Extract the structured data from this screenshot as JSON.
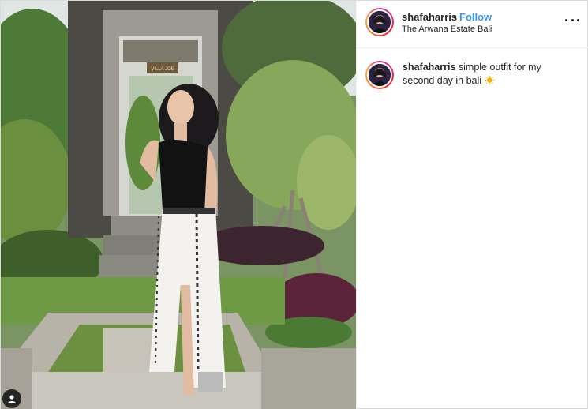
{
  "post": {
    "username": "shafaharris",
    "separator": "•",
    "follow_label": "Follow",
    "location": "The Arwana Estate Bali",
    "more_icon": "more-options-icon",
    "photo_sign_text": "VILLA JOE"
  },
  "caption": {
    "username": "shafaharris",
    "text": "simple outfit for my second day in bali",
    "emoji": "sun-emoji"
  },
  "colors": {
    "follow_blue": "#3897f0",
    "text": "#262626",
    "border": "#efefef"
  }
}
